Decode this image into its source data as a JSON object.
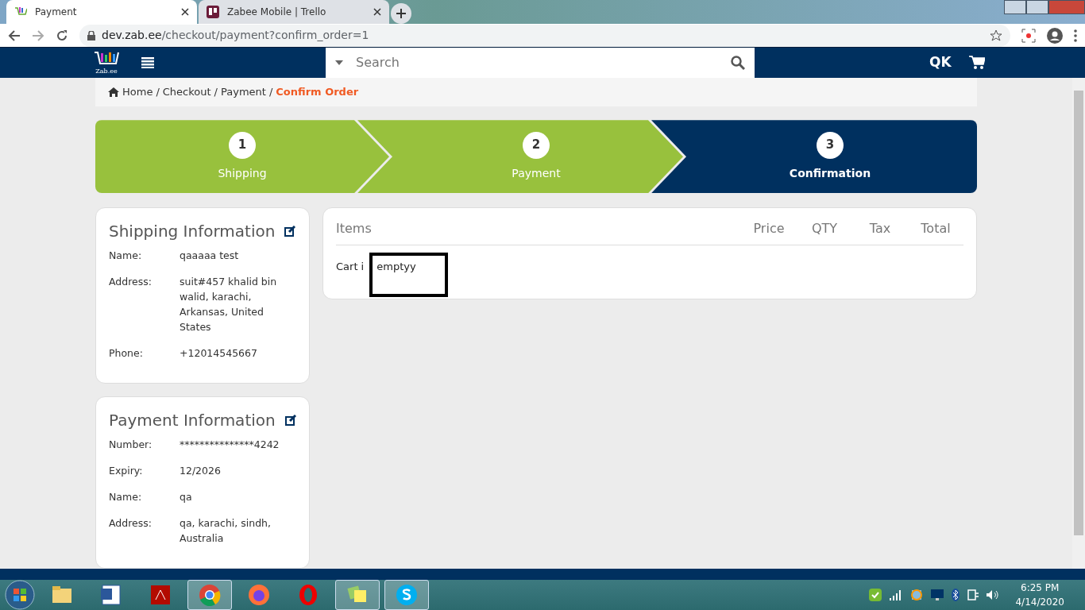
{
  "browser": {
    "tabs": [
      {
        "title": "Payment",
        "selected": true
      },
      {
        "title": "Zabee Mobile | Trello",
        "selected": false
      }
    ],
    "url": {
      "host": "dev.zab.ee",
      "path": "/checkout/payment?confirm_order=1"
    }
  },
  "site": {
    "logo_text": "Zab.ee",
    "search": {
      "placeholder": "Search"
    },
    "user_initials": "QK"
  },
  "breadcrumb": [
    {
      "label": "Home",
      "current": false
    },
    {
      "separator": "/",
      "label": "Checkout",
      "current": false
    },
    {
      "separator": "/",
      "label": "Payment",
      "current": false
    },
    {
      "separator": "/",
      "label": "Confirm Order",
      "current": true
    }
  ],
  "steps": [
    {
      "number": "1",
      "label": "Shipping",
      "selected": false
    },
    {
      "number": "2",
      "label": "Payment",
      "selected": false
    },
    {
      "number": "3",
      "label": "Confirmation",
      "selected": true
    }
  ],
  "shipping": {
    "title": "Shipping Information",
    "fields": [
      {
        "label": "Name:",
        "value": "qaaaaa test"
      },
      {
        "label": "Address:",
        "value": "suit#457 khalid bin walid, karachi, Arkansas, United States"
      },
      {
        "label": "Phone:",
        "value": "+12014545667"
      }
    ]
  },
  "payment": {
    "title": "Payment Information",
    "fields": [
      {
        "label": "Number:",
        "value": "***************4242"
      },
      {
        "label": "Expiry:",
        "value": "12/2026"
      },
      {
        "label": "Name:",
        "value": "qa"
      },
      {
        "label": "Address:",
        "value": "qa, karachi, sindh, Australia"
      }
    ]
  },
  "items": {
    "columns": [
      "Items",
      "Price",
      "QTY",
      "Tax",
      "Total"
    ],
    "message": [
      "Cart i",
      "emptyy"
    ]
  },
  "taskbar": {
    "apps": [
      {
        "kind": "folder",
        "selected": false
      },
      {
        "kind": "word",
        "selected": false
      },
      {
        "kind": "pdf",
        "selected": false
      },
      {
        "kind": "chrome",
        "selected": true
      },
      {
        "kind": "firefox",
        "selected": false
      },
      {
        "kind": "opera",
        "selected": false
      },
      {
        "kind": "notes",
        "selected": true
      },
      {
        "kind": "skype",
        "selected": true
      }
    ],
    "time": "6:25 PM",
    "date": "4/14/2020"
  }
}
